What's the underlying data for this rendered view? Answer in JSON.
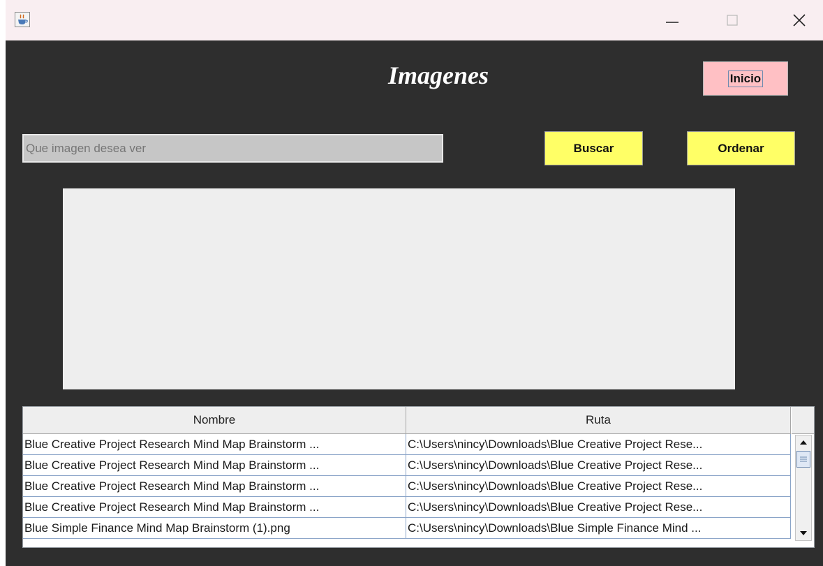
{
  "window": {
    "app_icon": "java-coffee-cup-icon",
    "controls": {
      "minimize": "minimize-icon",
      "maximize": "maximize-icon",
      "close": "close-icon"
    }
  },
  "header": {
    "title": "Imagenes",
    "inicio_label": "Inicio"
  },
  "search": {
    "placeholder": "Que imagen desea ver"
  },
  "toolbar": {
    "buscar_label": "Buscar",
    "ordenar_label": "Ordenar"
  },
  "table": {
    "columns": [
      "Nombre",
      "Ruta"
    ],
    "rows": [
      {
        "nombre": "Blue Creative Project Research Mind Map Brainstorm ...",
        "ruta": "C:\\Users\\nincy\\Downloads\\Blue Creative Project Rese..."
      },
      {
        "nombre": "Blue Creative Project Research Mind Map Brainstorm ...",
        "ruta": "C:\\Users\\nincy\\Downloads\\Blue Creative Project Rese..."
      },
      {
        "nombre": "Blue Creative Project Research Mind Map Brainstorm ...",
        "ruta": "C:\\Users\\nincy\\Downloads\\Blue Creative Project Rese..."
      },
      {
        "nombre": "Blue Creative Project Research Mind Map Brainstorm ...",
        "ruta": "C:\\Users\\nincy\\Downloads\\Blue Creative Project Rese..."
      },
      {
        "nombre": "Blue Simple Finance Mind Map Brainstorm (1).png",
        "ruta": "C:\\Users\\nincy\\Downloads\\Blue Simple Finance Mind ..."
      }
    ]
  },
  "colors": {
    "background": "#2e2e2e",
    "titlebar": "#f9eef1",
    "inicio_button": "#ffc0c4",
    "action_buttons": "#ffff66",
    "search_field": "#c6c6c6",
    "preview_panel": "#eeeeee"
  }
}
